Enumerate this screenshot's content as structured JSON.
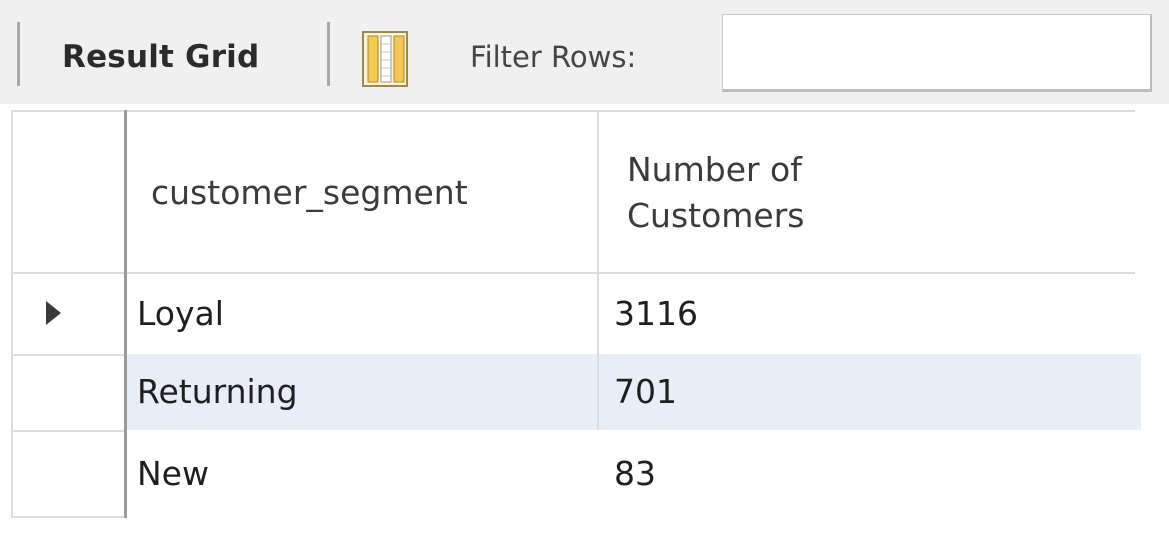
{
  "toolbar": {
    "result_grid_label": "Result Grid",
    "form_view_icon": "grid-columns-icon",
    "filter_label": "Filter Rows:",
    "filter_value": "",
    "filter_placeholder": ""
  },
  "grid": {
    "columns": [
      {
        "label": "customer_segment"
      },
      {
        "label": "Number of\nCustomers"
      }
    ],
    "rows": [
      {
        "customer_segment": "Loyal",
        "count": "3116",
        "current": true
      },
      {
        "customer_segment": "Returning",
        "count": "701",
        "current": false
      },
      {
        "customer_segment": "New",
        "count": "83",
        "current": false
      }
    ],
    "current_row_icon": "current-row-marker-icon",
    "colors": {
      "selected_row": "#e8eef8",
      "toolbar_bg": "#f0f0f0",
      "icon_fill": "#f5d36c"
    }
  }
}
